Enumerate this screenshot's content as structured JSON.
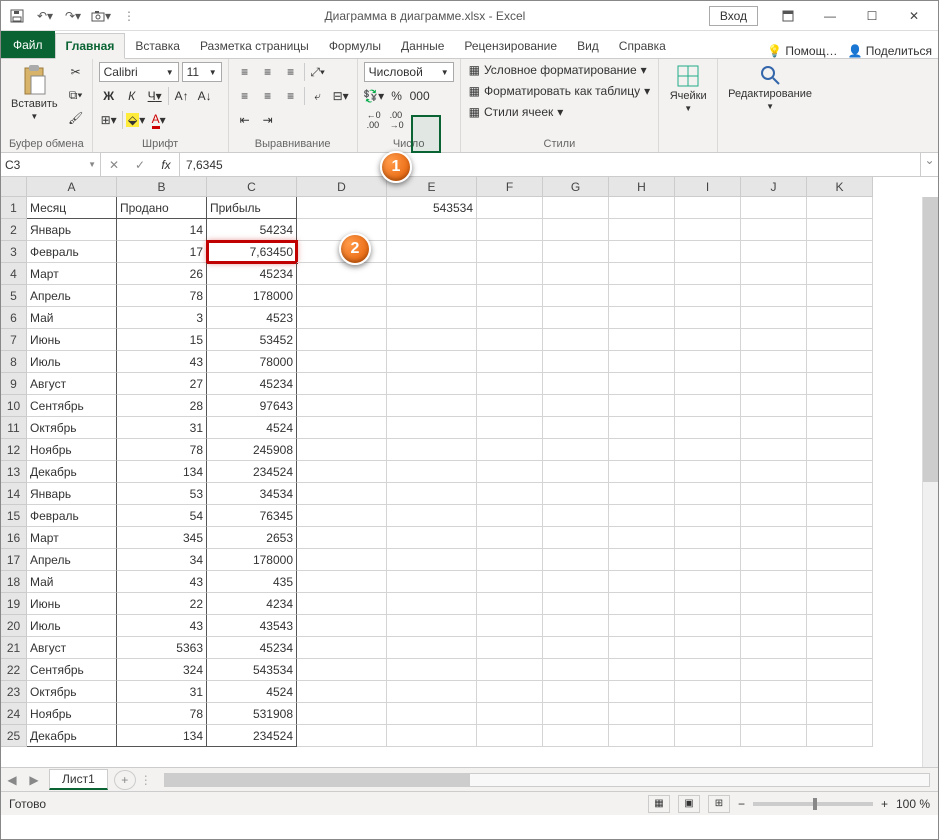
{
  "title": "Диаграмма в диаграмме.xlsx  -  Excel",
  "signin": "Вход",
  "tabs": {
    "file": "Файл",
    "home": "Главная",
    "insert": "Вставка",
    "layout": "Разметка страницы",
    "formulas": "Формулы",
    "data": "Данные",
    "review": "Рецензирование",
    "view": "Вид",
    "help": "Справка",
    "tellme": "Помощ…",
    "share": "Поделиться"
  },
  "ribbon": {
    "clipboard": {
      "paste": "Вставить",
      "label": "Буфер обмена"
    },
    "font": {
      "name": "Calibri",
      "size": "11",
      "label": "Шрифт",
      "bold": "Ж",
      "italic": "К",
      "underline": "Ч"
    },
    "align": {
      "label": "Выравнивание"
    },
    "number": {
      "format": "Числовой",
      "label": "Число"
    },
    "styles": {
      "cond": "Условное форматирование",
      "table": "Форматировать как таблицу",
      "cell": "Стили ячеек",
      "label": "Стили"
    },
    "cells": {
      "label": "Ячейки"
    },
    "editing": {
      "label": "Редактирование"
    }
  },
  "fx": {
    "name": "C3",
    "value": "7,6345"
  },
  "columns": [
    "A",
    "B",
    "C",
    "D",
    "E",
    "F",
    "G",
    "H",
    "I",
    "J",
    "K"
  ],
  "headers": {
    "a": "Месяц",
    "b": "Продано",
    "c": "Прибыль"
  },
  "e1": "543534",
  "rows": [
    {
      "n": "1"
    },
    {
      "n": "2",
      "a": "Январь",
      "b": "14",
      "c": "54234"
    },
    {
      "n": "3",
      "a": "Февраль",
      "b": "17",
      "c": "7,63450"
    },
    {
      "n": "4",
      "a": "Март",
      "b": "26",
      "c": "45234"
    },
    {
      "n": "5",
      "a": "Апрель",
      "b": "78",
      "c": "178000"
    },
    {
      "n": "6",
      "a": "Май",
      "b": "3",
      "c": "4523"
    },
    {
      "n": "7",
      "a": "Июнь",
      "b": "15",
      "c": "53452"
    },
    {
      "n": "8",
      "a": "Июль",
      "b": "43",
      "c": "78000"
    },
    {
      "n": "9",
      "a": "Август",
      "b": "27",
      "c": "45234"
    },
    {
      "n": "10",
      "a": "Сентябрь",
      "b": "28",
      "c": "97643"
    },
    {
      "n": "11",
      "a": "Октябрь",
      "b": "31",
      "c": "4524"
    },
    {
      "n": "12",
      "a": "Ноябрь",
      "b": "78",
      "c": "245908"
    },
    {
      "n": "13",
      "a": "Декабрь",
      "b": "134",
      "c": "234524"
    },
    {
      "n": "14",
      "a": "Январь",
      "b": "53",
      "c": "34534"
    },
    {
      "n": "15",
      "a": "Февраль",
      "b": "54",
      "c": "76345"
    },
    {
      "n": "16",
      "a": "Март",
      "b": "345",
      "c": "2653"
    },
    {
      "n": "17",
      "a": "Апрель",
      "b": "34",
      "c": "178000"
    },
    {
      "n": "18",
      "a": "Май",
      "b": "43",
      "c": "435"
    },
    {
      "n": "19",
      "a": "Июнь",
      "b": "22",
      "c": "4234"
    },
    {
      "n": "20",
      "a": "Июль",
      "b": "43",
      "c": "43543"
    },
    {
      "n": "21",
      "a": "Август",
      "b": "5363",
      "c": "45234"
    },
    {
      "n": "22",
      "a": "Сентябрь",
      "b": "324",
      "c": "543534"
    },
    {
      "n": "23",
      "a": "Октябрь",
      "b": "31",
      "c": "4524"
    },
    {
      "n": "24",
      "a": "Ноябрь",
      "b": "78",
      "c": "531908"
    },
    {
      "n": "25",
      "a": "Декабрь",
      "b": "134",
      "c": "234524"
    }
  ],
  "sheet": "Лист1",
  "status": "Готово",
  "zoom": "100 %",
  "callouts": {
    "c1": "1",
    "c2": "2"
  }
}
